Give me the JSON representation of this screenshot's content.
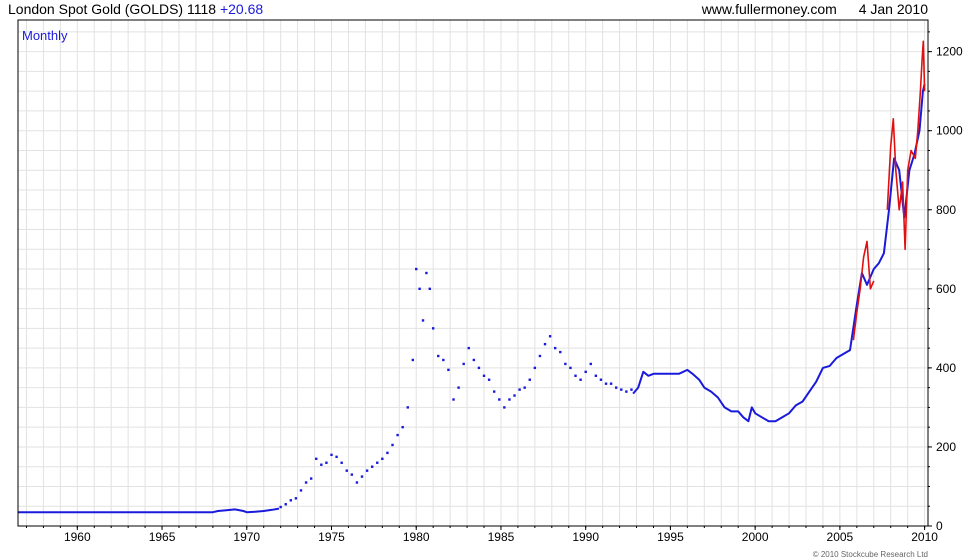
{
  "header": {
    "instrument": "London Spot Gold (GOLDS) 1118",
    "change": "+20.68",
    "source": "www.fullermoney.com",
    "date": "4 Jan 2010"
  },
  "footer": {
    "copyright": "© 2010 Stockcube Research Ltd"
  },
  "colors": {
    "up": "#1a1adb",
    "down": "#e01010",
    "grid": "#e2e2e2",
    "axis": "#000000"
  },
  "chart_data": {
    "type": "line",
    "period_label": "Monthly",
    "x_tick_labels": [
      "1960",
      "1965",
      "1970",
      "1975",
      "1980",
      "1985",
      "1990",
      "1995",
      "2000",
      "2005",
      "2010"
    ],
    "y_tick_labels": [
      "0",
      "200",
      "400",
      "600",
      "800",
      "1000",
      "1200"
    ],
    "xlim": [
      1956.5,
      2010.2
    ],
    "ylim": [
      0,
      1280
    ],
    "grid": true,
    "y_axis_side": "right",
    "series": [
      {
        "style": "line",
        "color": "#1a1adb",
        "x": [
          1956.5,
          1968.0,
          1968.3,
          1968.8,
          1969.3,
          1969.8,
          1970.0,
          1970.5,
          1971.0,
          1971.5,
          1971.9
        ],
        "values": [
          35,
          35,
          38,
          40,
          42,
          38,
          35,
          36,
          38,
          41,
          44
        ]
      },
      {
        "style": "dots",
        "color": "#1a1adb",
        "x": [
          1972.0,
          1972.3,
          1972.6,
          1972.9,
          1973.2,
          1973.5,
          1973.8,
          1974.1,
          1974.4,
          1974.7,
          1975.0,
          1975.3,
          1975.6,
          1975.9,
          1976.2,
          1976.5,
          1976.8,
          1977.1,
          1977.4,
          1977.7,
          1978.0,
          1978.3,
          1978.6,
          1978.9,
          1979.2,
          1979.5,
          1979.8,
          1980.0,
          1980.2,
          1980.4,
          1980.6,
          1980.8,
          1981.0,
          1981.3,
          1981.6,
          1981.9,
          1982.2,
          1982.5,
          1982.8,
          1983.1,
          1983.4,
          1983.7,
          1984.0,
          1984.3,
          1984.6,
          1984.9,
          1985.2,
          1985.5,
          1985.8,
          1986.1,
          1986.4,
          1986.7,
          1987.0,
          1987.3,
          1987.6,
          1987.9,
          1988.2,
          1988.5,
          1988.8,
          1989.1,
          1989.4,
          1989.7,
          1990.0,
          1990.3,
          1990.6,
          1990.9,
          1991.2,
          1991.5,
          1991.8,
          1992.1,
          1992.4,
          1992.7
        ],
        "values": [
          48,
          55,
          65,
          70,
          90,
          110,
          120,
          170,
          155,
          160,
          180,
          175,
          160,
          140,
          130,
          110,
          125,
          140,
          150,
          160,
          170,
          185,
          205,
          230,
          250,
          300,
          420,
          650,
          600,
          520,
          640,
          600,
          500,
          430,
          420,
          395,
          320,
          350,
          410,
          450,
          420,
          400,
          380,
          370,
          340,
          320,
          300,
          320,
          330,
          345,
          350,
          370,
          400,
          430,
          460,
          480,
          450,
          440,
          410,
          400,
          380,
          370,
          390,
          410,
          380,
          370,
          360,
          360,
          350,
          345,
          340,
          345
        ]
      },
      {
        "style": "line",
        "color": "#1a1adb",
        "x": [
          1992.8,
          1993.1,
          1993.4,
          1993.7,
          1994.0,
          1994.5,
          1995.0,
          1995.5,
          1996.0,
          1996.3,
          1996.7,
          1997.0,
          1997.4,
          1997.8,
          1998.2,
          1998.6,
          1999.0,
          1999.3,
          1999.6,
          1999.8,
          2000.0,
          2000.4,
          2000.8,
          2001.2,
          2001.6,
          2002.0,
          2002.4,
          2002.8,
          2003.2,
          2003.6,
          2004.0,
          2004.4,
          2004.8,
          2005.2,
          2005.6,
          2006.0,
          2006.3,
          2006.6,
          2007.0,
          2007.3,
          2007.6,
          2007.9,
          2008.2,
          2008.5,
          2008.8,
          2009.1,
          2009.4,
          2009.7,
          2009.9,
          2010.0
        ],
        "values": [
          335,
          350,
          390,
          380,
          385,
          385,
          385,
          385,
          395,
          385,
          370,
          350,
          340,
          325,
          300,
          290,
          290,
          275,
          265,
          300,
          285,
          275,
          265,
          265,
          275,
          285,
          305,
          315,
          340,
          365,
          400,
          405,
          425,
          435,
          445,
          560,
          640,
          610,
          650,
          665,
          690,
          800,
          930,
          900,
          780,
          900,
          940,
          1000,
          1100,
          1118
        ]
      },
      {
        "style": "line",
        "color": "#e01010",
        "x": [
          2005.8,
          2006.0,
          2006.2,
          2006.4,
          2006.6,
          2006.8,
          2007.0
        ],
        "values": [
          470,
          540,
          600,
          680,
          720,
          600,
          620
        ]
      },
      {
        "style": "line",
        "color": "#e01010",
        "x": [
          2007.8,
          2008.0,
          2008.15,
          2008.3,
          2008.5,
          2008.7,
          2008.85,
          2009.0,
          2009.2,
          2009.45,
          2009.6,
          2009.75,
          2009.85,
          2009.92,
          2010.0
        ],
        "values": [
          800,
          960,
          1030,
          900,
          800,
          870,
          700,
          900,
          950,
          930,
          1000,
          1100,
          1180,
          1226,
          1100
        ]
      }
    ]
  }
}
